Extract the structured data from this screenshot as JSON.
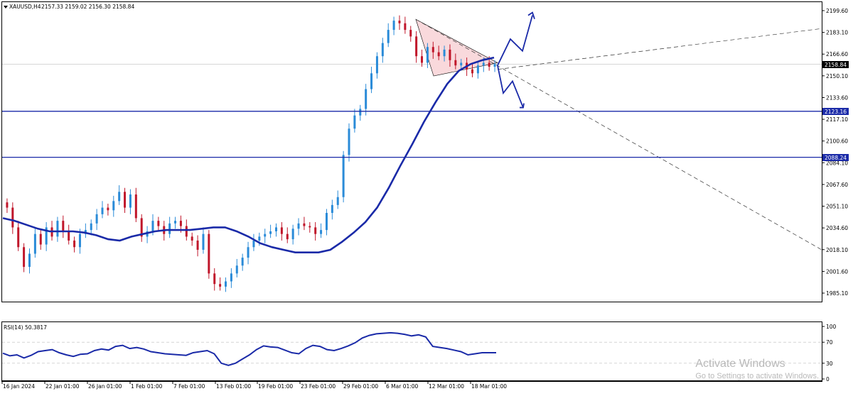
{
  "header": {
    "symbol_label": "XAUUSD,H4",
    "ohlc_label": "2157.33 2159.02 2156.30 2158.84",
    "menu_icon": "triangle-down-icon"
  },
  "price_axis": {
    "ticks": [
      2199.6,
      2183.1,
      2166.6,
      2150.1,
      2133.6,
      2117.1,
      2100.6,
      2084.1,
      2067.6,
      2051.1,
      2034.6,
      2018.1,
      2001.6,
      1985.1
    ],
    "tick_labels": [
      "2199.60",
      "2183.10",
      "2166.60",
      "2150.10",
      "2133.60",
      "2117.10",
      "2100.60",
      "2084.10",
      "2067.60",
      "2051.10",
      "2034.60",
      "2018.10",
      "2001.60",
      "1985.10"
    ],
    "current_price_label": "2158.84",
    "level_labels": [
      "2123.16",
      "2088.24"
    ]
  },
  "time_axis": {
    "labels": [
      "16 Jan 2024",
      "22 Jan 01:00",
      "26 Jan 01:00",
      "1 Feb 01:00",
      "7 Feb 01:00",
      "13 Feb 01:00",
      "19 Feb 01:00",
      "23 Feb 01:00",
      "29 Feb 01:00",
      "6 Mar 01:00",
      "12 Mar 01:00",
      "18 Mar 01:00"
    ]
  },
  "rsi": {
    "label": "RSI(14) 50.3817",
    "tick_labels": [
      "100",
      "70",
      "30",
      "0"
    ],
    "ticks": [
      100,
      70,
      30,
      0
    ],
    "levels": [
      70,
      30
    ]
  },
  "colors": {
    "bull": "#2a8bd8",
    "bear": "#c0162a",
    "ma": "#1a2aa8",
    "level": "#1a2aa8",
    "arrow": "#1a2aa8",
    "triangle": "#f9d9dc",
    "grid": "#d6d6d6"
  },
  "watermark": {
    "title": "Activate Windows",
    "subtitle": "Go to Settings to activate Windows."
  },
  "chart_data": {
    "type": "candlestick",
    "symbol": "XAUUSD",
    "timeframe": "H4",
    "ylim": [
      1977,
      2208
    ],
    "horizontal_levels": [
      2123.16,
      2088.24
    ],
    "current_price": 2158.84,
    "ma_values": [
      2042,
      2040,
      2037,
      2034,
      2032,
      2032,
      2032,
      2031,
      2029,
      2026,
      2025,
      2028,
      2030,
      2032,
      2033,
      2033,
      2033,
      2034,
      2035,
      2035,
      2032,
      2028,
      2023,
      2020,
      2018,
      2016,
      2016,
      2016,
      2018,
      2024,
      2031,
      2039,
      2050,
      2065,
      2082,
      2098,
      2115,
      2130,
      2144,
      2154,
      2159,
      2162,
      2164
    ],
    "candle_closes": [
      2050,
      2035,
      2020,
      2005,
      2015,
      2030,
      2022,
      2035,
      2028,
      2040,
      2032,
      2025,
      2020,
      2030,
      2033,
      2038,
      2045,
      2050,
      2048,
      2055,
      2062,
      2050,
      2060,
      2042,
      2028,
      2032,
      2040,
      2036,
      2030,
      2038,
      2040,
      2036,
      2028,
      2025,
      2018,
      2030,
      2000,
      1992,
      1990,
      1994,
      2000,
      2006,
      2012,
      2020,
      2025,
      2028,
      2030,
      2032,
      2035,
      2030,
      2026,
      2034,
      2038,
      2036,
      2035,
      2030,
      2033,
      2046,
      2052,
      2058,
      2090,
      2110,
      2120,
      2125,
      2140,
      2152,
      2165,
      2175,
      2185,
      2192,
      2190,
      2185,
      2180,
      2165,
      2160,
      2172,
      2168,
      2165,
      2170,
      2162,
      2158,
      2160,
      2155,
      2152,
      2158,
      2160,
      2157,
      2159
    ],
    "patterns": [
      {
        "type": "descending-triangle",
        "from_price": 2193,
        "to_price": 2158
      },
      {
        "type": "trendline-up",
        "from_price": 2155,
        "to_price": 2186
      },
      {
        "type": "trendline-down",
        "from_price": 2193,
        "to_price": 2018
      }
    ],
    "scenario_arrows": [
      {
        "direction": "up",
        "target": 2196
      },
      {
        "direction": "down",
        "target": 2126
      }
    ],
    "rsi_values": [
      49,
      44,
      46,
      40,
      45,
      52,
      54,
      56,
      50,
      46,
      43,
      47,
      48,
      54,
      57,
      55,
      62,
      64,
      58,
      60,
      57,
      52,
      50,
      48,
      47,
      46,
      45,
      50,
      52,
      54,
      48,
      30,
      26,
      30,
      38,
      46,
      56,
      63,
      61,
      60,
      55,
      50,
      48,
      58,
      64,
      62,
      56,
      54,
      58,
      63,
      69,
      78,
      83,
      86,
      87,
      88,
      87,
      85,
      82,
      84,
      80,
      62,
      60,
      58,
      55,
      52,
      46,
      48,
      50,
      50,
      50
    ]
  }
}
